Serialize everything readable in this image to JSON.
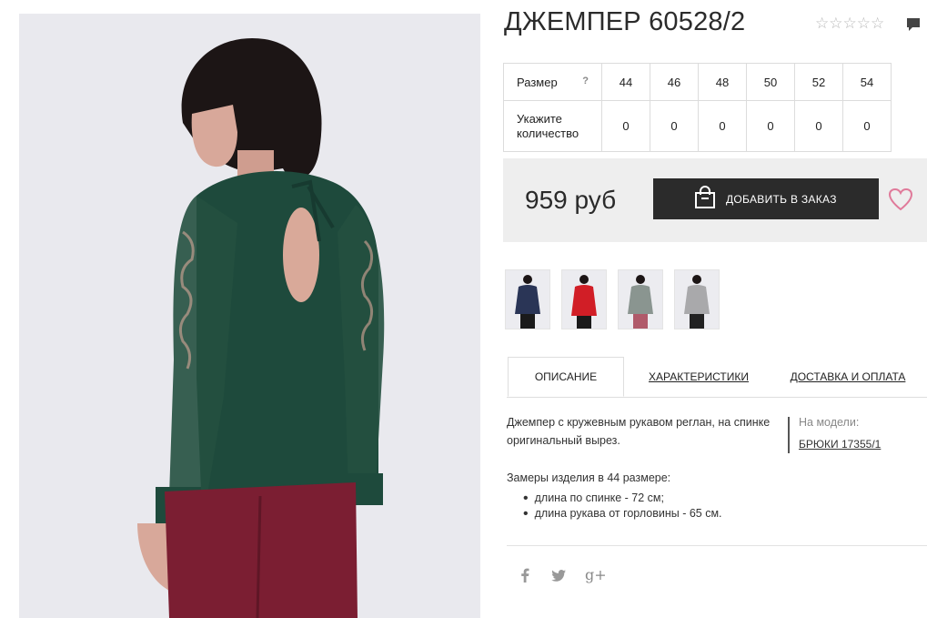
{
  "product": {
    "title": "ДЖЕМПЕР 60528/2",
    "rating_stars": "☆☆☆☆☆",
    "price": "959 руб"
  },
  "size_table": {
    "size_label": "Размер",
    "help_mark": "?",
    "quantity_label": "Укажите количество",
    "sizes": [
      "44",
      "46",
      "48",
      "50",
      "52",
      "54"
    ],
    "quantities": [
      "0",
      "0",
      "0",
      "0",
      "0",
      "0"
    ]
  },
  "cart": {
    "add_button_label": "ДОБАВИТЬ В ЗАКАЗ"
  },
  "thumbnails": [
    {
      "color": "#2a3556"
    },
    {
      "color": "#d11e26"
    },
    {
      "color": "#8a9590"
    },
    {
      "color": "#a9a9ab"
    }
  ],
  "tabs": [
    {
      "label": "ОПИСАНИЕ"
    },
    {
      "label": "ХАРАКТЕРИСТИКИ"
    },
    {
      "label": "ДОСТАВКА И ОПЛАТА"
    }
  ],
  "description": {
    "text": "Джемпер с кружевным рукавом реглан, на спинке оригинальный вырез.",
    "model_label": "На модели:",
    "model_link": "БРЮКИ 17355/1",
    "measurements_title": "Замеры изделия в 44 размере:",
    "measurements": [
      "длина по спинке - 72 см;",
      "длина рукава от горловины - 65 см."
    ]
  },
  "social": {
    "facebook": "f",
    "twitter": "t",
    "google_plus": "g+"
  },
  "colors": {
    "button_dark": "#2b2b2b",
    "heart_pink": "#e07a9a",
    "jumper_green": "#1e4a3c",
    "trousers_burgundy": "#7b1e32"
  }
}
